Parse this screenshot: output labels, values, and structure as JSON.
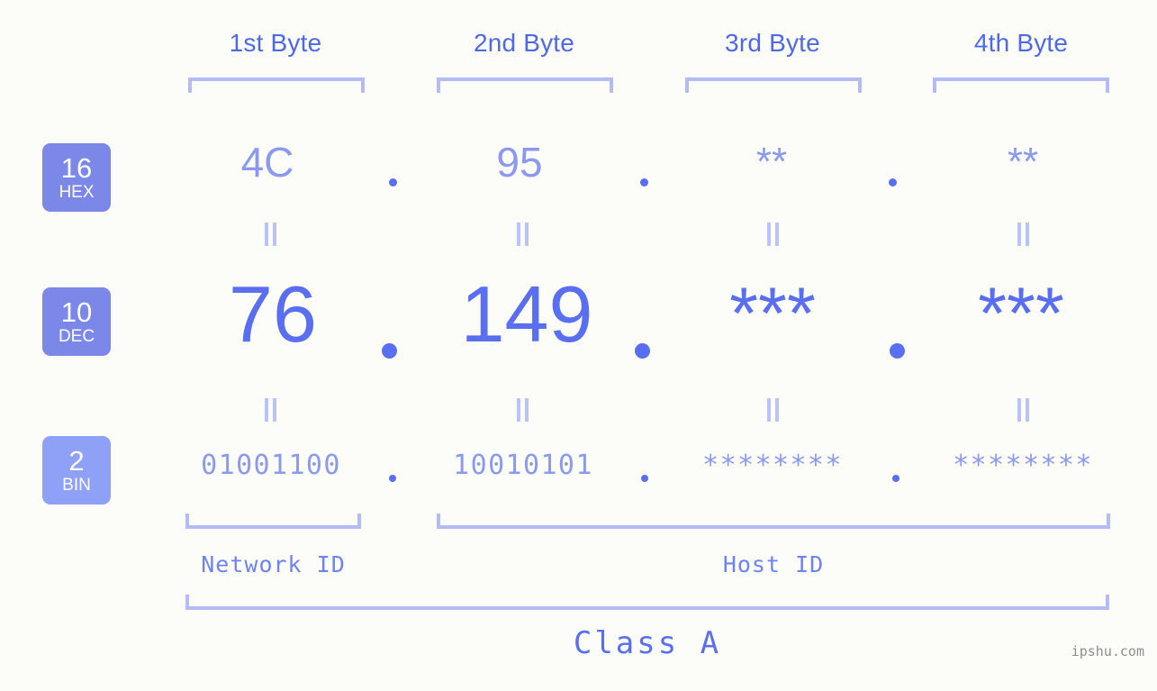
{
  "header": {
    "byte_labels": [
      "1st Byte",
      "2nd Byte",
      "3rd Byte",
      "4th Byte"
    ]
  },
  "bases": [
    {
      "number": "16",
      "name": "HEX",
      "color": "#7b88e8"
    },
    {
      "number": "10",
      "name": "DEC",
      "color": "#7b88e8"
    },
    {
      "number": "2",
      "name": "BIN",
      "color": "#8fa0f7"
    }
  ],
  "rows": {
    "hex": {
      "values": [
        "4C",
        "95",
        "**",
        "**"
      ]
    },
    "dec": {
      "values": [
        "76",
        "149",
        "***",
        "***"
      ]
    },
    "bin": {
      "values": [
        "01001100",
        "10010101",
        "********",
        "********"
      ]
    }
  },
  "separators": {
    "dot": ".",
    "equality": "||"
  },
  "footer": {
    "network_id_label": "Network ID",
    "host_id_label": "Host ID",
    "class_label": "Class A",
    "watermark": "ipshu.com"
  },
  "colors": {
    "background": "#fcfdf8",
    "accent_strong": "#5a6ff0",
    "accent_mid": "#8b99ee",
    "accent_light": "#b3bcf7",
    "badge": "#7b88e8",
    "badge_light": "#8fa0f7",
    "watermark": "#8e8e8e"
  }
}
